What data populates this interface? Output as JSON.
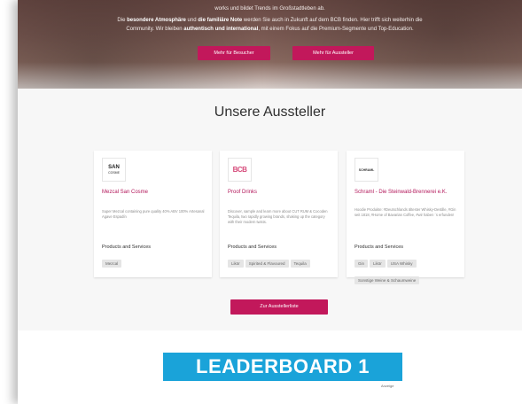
{
  "hero": {
    "line1": "works und bildet Trends im Großstadtleben ab.",
    "line2_pre": "Die ",
    "line2_b1": "besondere Atmosphäre",
    "line2_mid1": " und ",
    "line2_b2": "die familiäre Note",
    "line2_post": " werden Sie auch in Zukunft auf dem BCB finden. Hier trifft sich weiterhin die",
    "line3_pre": "Community. Wir bleiben ",
    "line3_b": "authentisch und international",
    "line3_post": ", mit einem Fokus auf die Premium-Segmente und Top-Education.",
    "btn_visitors": "Mehr für Besucher",
    "btn_exhibitors": "Mehr für Aussteller"
  },
  "section_title": "Unsere Aussteller",
  "products_label": "Products and Services",
  "cards": [
    {
      "logo_text_1": "SAN",
      "logo_text_2": "COSME",
      "title": "Mezcal San Cosme",
      "desc": "Super Mezcal containing pure quality 40% ABV 100% Artesanal Agave Espadín",
      "tags": [
        "Mezcal"
      ]
    },
    {
      "logo_text_1": "BCB",
      "logo_text_2": "",
      "title": "Proof Drinks",
      "desc": "Discover, sample and learn more about CUT RUM & Cocoden Tequila, two rapidly growing brands, shaking up the category with their modern twists.",
      "tags": [
        "Likör",
        "Spirited & Flavoured",
        "Tequila"
      ]
    },
    {
      "logo_text_1": "SCHRAML",
      "logo_text_2": "",
      "title": "Schraml - Die Steinwald-Brennerei e.K.",
      "desc": "Hoodie Produkte: #Deutschlands ältester Whisky-Destille, #Gin seit 1818, #Home of Bavarian Coffee, #wir haben ´s erfunden!",
      "tags": [
        "Gin",
        "Likör",
        "USA Whisky",
        "Sonstige Weine & Schaumweine"
      ]
    }
  ],
  "list_button": "Zur Ausstellerliste",
  "ad": {
    "banner": "LEADERBOARD 1",
    "label": "Anzeige"
  }
}
